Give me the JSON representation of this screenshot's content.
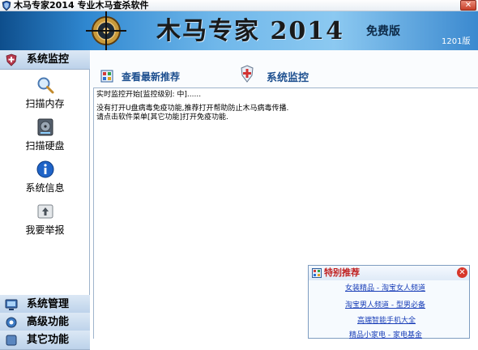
{
  "window": {
    "title": "木马专家2014  专业木马查杀软件",
    "close_glyph": "✕"
  },
  "banner": {
    "title": "木马专家 2014",
    "edition": "免费版",
    "version": "1201版"
  },
  "sidebar": {
    "header": "系统监控",
    "items": [
      {
        "label": "扫描内存",
        "icon": "magnifier-icon"
      },
      {
        "label": "扫描硬盘",
        "icon": "hard-disk-icon"
      },
      {
        "label": "系统信息",
        "icon": "info-icon"
      },
      {
        "label": "我要举报",
        "icon": "report-icon"
      }
    ],
    "bottom_sections": [
      "系统管理",
      "高级功能",
      "其它功能"
    ]
  },
  "content": {
    "tab_news": "查看最新推荐",
    "tab_monitor": "系统监控",
    "log": [
      "实时监控开始[监控级别: 中]......",
      "没有打开U盘病毒免疫功能,推荐打开帮助防止木马病毒传播.",
      "请点击软件菜单[其它功能]打开免疫功能."
    ]
  },
  "popup": {
    "title": "特别推荐",
    "close_glyph": "✕",
    "links": [
      "女装精品 - 淘宝女人频道",
      "淘宝男人频道 - 型男必备",
      "高端智能手机大全",
      "精品小家电 - 家电基金"
    ]
  },
  "colors": {
    "accent": "#1d4f8f",
    "banner_blue": "#2f87d0",
    "popup_title": "#c02020",
    "link": "#1a3fb8"
  }
}
